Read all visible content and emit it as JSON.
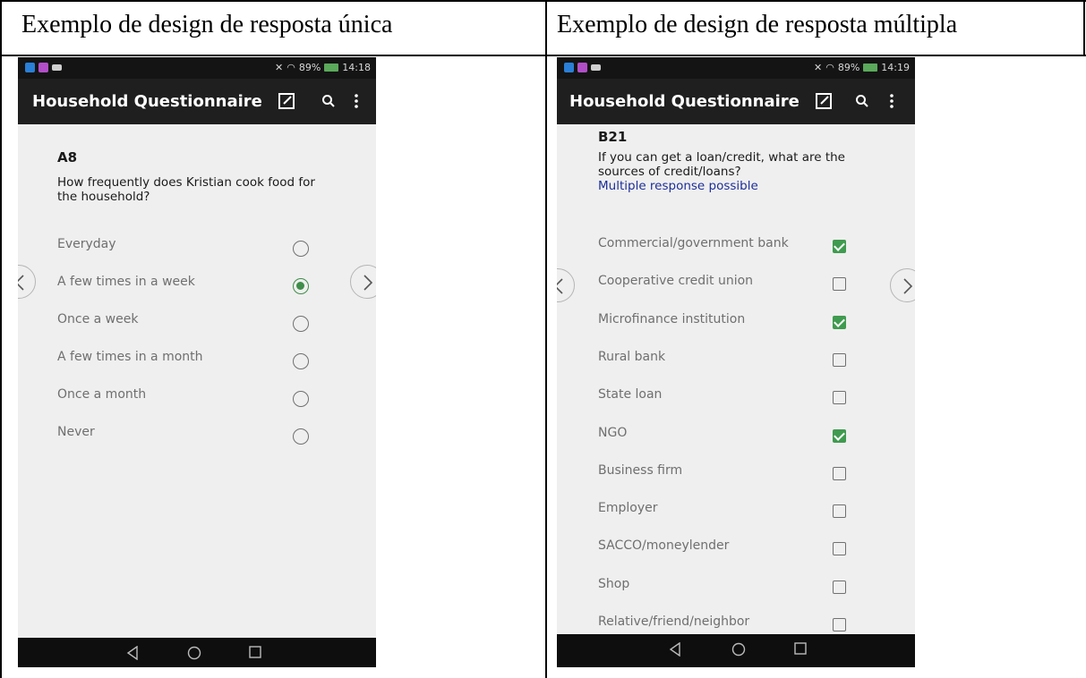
{
  "headers": {
    "left": "Exemplo de design de resposta única",
    "right": "Exemplo de design de resposta múltipla"
  },
  "left_screen": {
    "status": {
      "battery": "89%",
      "time": "14:18"
    },
    "app_title": "Household Questionnaire",
    "question": {
      "code": "A8",
      "text": "How frequently does Kristian cook food for the household?"
    },
    "selected_index": 1,
    "options": [
      {
        "label": "Everyday",
        "selected": false
      },
      {
        "label": "A few times in a week",
        "selected": true
      },
      {
        "label": "Once a week",
        "selected": false
      },
      {
        "label": "A few times in a month",
        "selected": false
      },
      {
        "label": "Once a month",
        "selected": false
      },
      {
        "label": "Never",
        "selected": false
      }
    ]
  },
  "right_screen": {
    "status": {
      "battery": "89%",
      "time": "14:19"
    },
    "app_title": "Household Questionnaire",
    "question": {
      "code": "B21",
      "text": "If you can get a loan/credit, what are the sources of credit/loans?",
      "note": "Multiple response possible"
    },
    "options": [
      {
        "label": "Commercial/government bank",
        "checked": true
      },
      {
        "label": "Cooperative credit union",
        "checked": false
      },
      {
        "label": "Microfinance institution",
        "checked": true
      },
      {
        "label": "Rural bank",
        "checked": false
      },
      {
        "label": "State loan",
        "checked": false
      },
      {
        "label": "NGO",
        "checked": true
      },
      {
        "label": "Business firm",
        "checked": false
      },
      {
        "label": "Employer",
        "checked": false
      },
      {
        "label": "SACCO/moneylender",
        "checked": false
      },
      {
        "label": "Shop",
        "checked": false
      },
      {
        "label": "Relative/friend/neighbor",
        "checked": false
      }
    ]
  },
  "colors": {
    "accent_green": "#3e8e4a",
    "note_blue": "#1d2f9a",
    "appbar": "#1f1f1f",
    "screen_bg": "#efefef"
  }
}
